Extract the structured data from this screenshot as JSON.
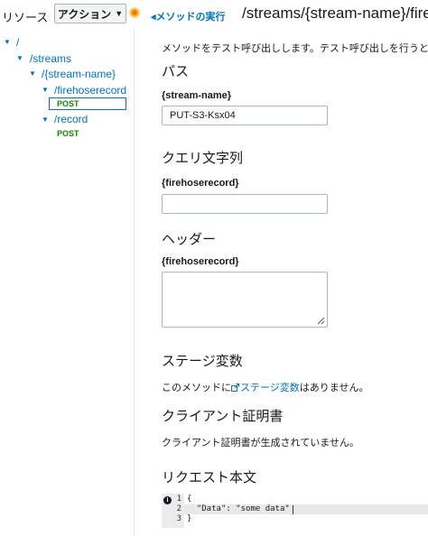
{
  "header": {
    "resources_label": "リソース",
    "actions_label": "アクション",
    "back_link": "メソッドの実行",
    "page_title": "/streams/{stream-name}/fireho"
  },
  "tree": {
    "root": "/",
    "streams": "/streams",
    "stream_name": "/{stream-name}",
    "firehoserecord": "/firehoserecord",
    "firehoserecord_method": "POST",
    "record": "/record",
    "record_method": "POST"
  },
  "main": {
    "description": "メソッドをテスト呼び出しします。テスト呼び出しを行うと、A",
    "path": {
      "heading": "パス",
      "field_label": "{stream-name}",
      "field_value": "PUT-S3-Ksx04"
    },
    "query": {
      "heading": "クエリ文字列",
      "field_label": "{firehoserecord}",
      "field_value": ""
    },
    "headers": {
      "heading": "ヘッダー",
      "field_label": "{firehoserecord}",
      "field_value": ""
    },
    "stage": {
      "heading": "ステージ変数",
      "text_before": "このメソッドに",
      "link": "ステージ変数",
      "text_after": "はありません。"
    },
    "client_cert": {
      "heading": "クライアント証明書",
      "text": "クライアント証明書が生成されていません。"
    },
    "request_body": {
      "heading": "リクエスト本文",
      "lines": [
        "{",
        "  \"Data\": \"some data\"",
        "}"
      ],
      "line_numbers": [
        "1",
        "2",
        "3"
      ]
    }
  },
  "colors": {
    "link": "#0073bb",
    "method_post": "#1d8102",
    "accent_orange": "#ff9900"
  },
  "icons": [
    "caret-down-icon",
    "back-arrow-icon",
    "external-link-icon",
    "info-icon",
    "resize-grip-icon"
  ]
}
